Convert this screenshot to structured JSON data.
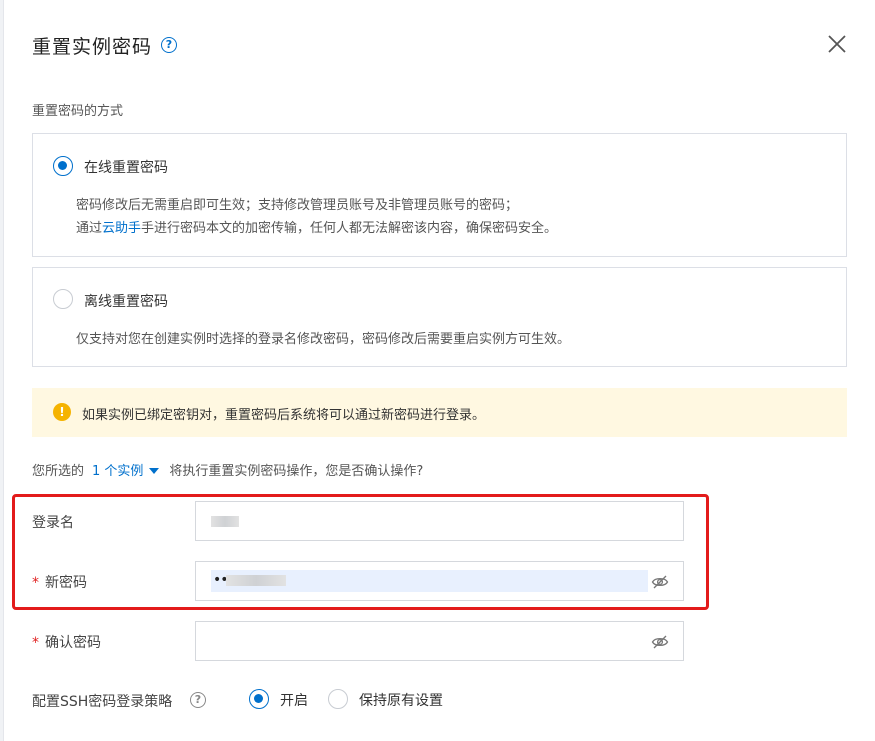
{
  "dialog": {
    "title": "重置实例密码",
    "help_glyph": "?",
    "close_icon": "close-icon"
  },
  "method": {
    "section_label": "重置密码的方式",
    "options": [
      {
        "title": "在线重置密码",
        "selected": true,
        "line1": "密码修改后无需重启即可生效；支持修改管理员账号及非管理员账号的密码；",
        "line2_prefix": "通过",
        "line2_link": "云助手",
        "line2_suffix": "手进行密码本文的加密传输，任何人都无法解密该内容，确保密码安全。"
      },
      {
        "title": "离线重置密码",
        "selected": false,
        "line1": "仅支持对您在创建实例时选择的登录名修改密码，密码修改后需要重启实例方可生效。"
      }
    ]
  },
  "warning": {
    "icon": "warning-icon",
    "glyph": "!",
    "text": "如果实例已绑定密钥对，重置密码后系统将可以通过新密码进行登录。"
  },
  "confirm": {
    "prefix": "您所选的",
    "instances_link": "1 个实例",
    "suffix": "将执行重置实例密码操作，您是否确认操作?"
  },
  "form": {
    "login_name": {
      "label": "登录名",
      "required": false
    },
    "new_password": {
      "label": "新密码",
      "required": true,
      "value_mask": "••"
    },
    "confirm_password": {
      "label": "确认密码",
      "required": true
    },
    "required_mark": "*"
  },
  "ssh": {
    "label": "配置SSH密码登录策略",
    "help_glyph": "?",
    "options": [
      {
        "label": "开启",
        "selected": true
      },
      {
        "label": "保持原有设置",
        "selected": false
      }
    ]
  },
  "colors": {
    "accent": "#0070cc",
    "warning_bg": "#fff8e1",
    "warning_icon": "#f5b300",
    "required": "#e02020",
    "highlight": "#e31b1b"
  }
}
